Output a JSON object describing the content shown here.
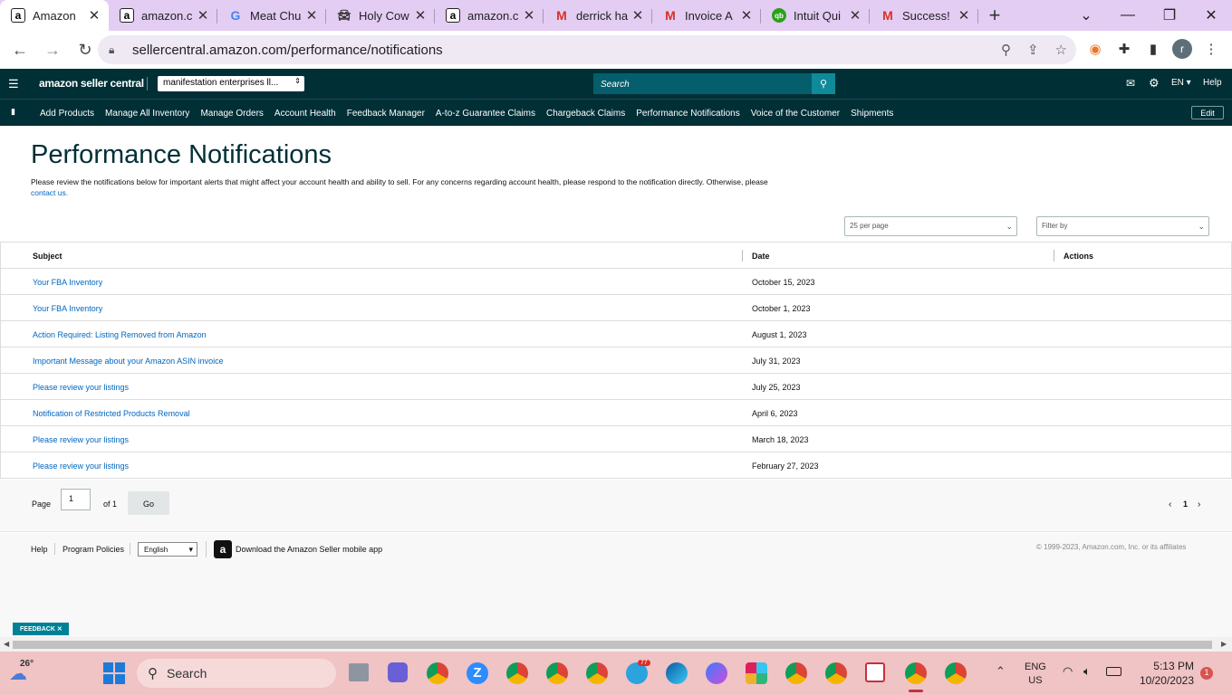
{
  "browser": {
    "tabs": [
      {
        "title": "Amazon",
        "favicon": "a",
        "active": true
      },
      {
        "title": "amazon.c",
        "favicon": "a",
        "active": false
      },
      {
        "title": "Meat Chu",
        "favicon": "G",
        "active": false
      },
      {
        "title": "Holy Cow",
        "favicon": "car",
        "active": false
      },
      {
        "title": "amazon.c",
        "favicon": "a",
        "active": false
      },
      {
        "title": "derrick ha",
        "favicon": "M",
        "active": false
      },
      {
        "title": "Invoice A",
        "favicon": "M",
        "active": false
      },
      {
        "title": "Intuit Qui",
        "favicon": "qb",
        "active": false
      },
      {
        "title": "Success!",
        "favicon": "M",
        "active": false
      }
    ],
    "new_tab": "+",
    "url": "sellercentral.amazon.com/performance/notifications",
    "profile_initial": "r"
  },
  "seller_central": {
    "logo": "amazon seller central",
    "account_selector": "manifestation enterprises ll...",
    "search_placeholder": "Search",
    "language": "EN",
    "help": "Help",
    "nav_items": [
      "Add Products",
      "Manage All Inventory",
      "Manage Orders",
      "Account Health",
      "Feedback Manager",
      "A-to-z Guarantee Claims",
      "Chargeback Claims",
      "Performance Notifications",
      "Voice of the Customer",
      "Shipments"
    ],
    "edit": "Edit"
  },
  "page": {
    "title": "Performance Notifications",
    "intro": "Please review the notifications below for important alerts that might affect your account health and ability to sell. For any concerns regarding account health, please respond to the notification directly. Otherwise, please",
    "contact_link": "contact us.",
    "per_page": "25 per page",
    "filter_placeholder": "Filter by"
  },
  "table": {
    "headers": {
      "subject": "Subject",
      "date": "Date",
      "actions": "Actions"
    },
    "rows": [
      {
        "subject": "Your FBA Inventory",
        "date": "October 15, 2023"
      },
      {
        "subject": "Your FBA Inventory",
        "date": "October 1, 2023"
      },
      {
        "subject": "Action Required: Listing Removed from Amazon",
        "date": "August 1, 2023"
      },
      {
        "subject": "Important Message about your Amazon ASIN invoice",
        "date": "July 31, 2023"
      },
      {
        "subject": "Please review your listings",
        "date": "July 25, 2023"
      },
      {
        "subject": "Notification of Restricted Products Removal",
        "date": "April 6, 2023"
      },
      {
        "subject": "Please review your listings",
        "date": "March 18, 2023"
      },
      {
        "subject": "Please review your listings",
        "date": "February 27, 2023"
      }
    ]
  },
  "pager": {
    "page_label": "Page",
    "page_value": "1",
    "of_label": "of 1",
    "go": "Go",
    "current": "1"
  },
  "footer": {
    "help": "Help",
    "program_policies": "Program Policies",
    "language_option": "English",
    "download_app": "Download the Amazon Seller mobile app",
    "copyright": "© 1999-2023, Amazon.com, Inc. or its affiliates"
  },
  "feedback": "FEEDBACK",
  "taskbar": {
    "weather": "26°",
    "search": "Search",
    "telegram_badge": "77",
    "lang_top": "ENG",
    "lang_bottom": "US",
    "time": "5:13 PM",
    "date": "10/20/2023",
    "notification_count": "1"
  },
  "colors": {
    "tabbar": "#e3cdf3",
    "seller_header": "#002f36",
    "link": "#0066c0",
    "taskbar": "#f0c3c5"
  }
}
